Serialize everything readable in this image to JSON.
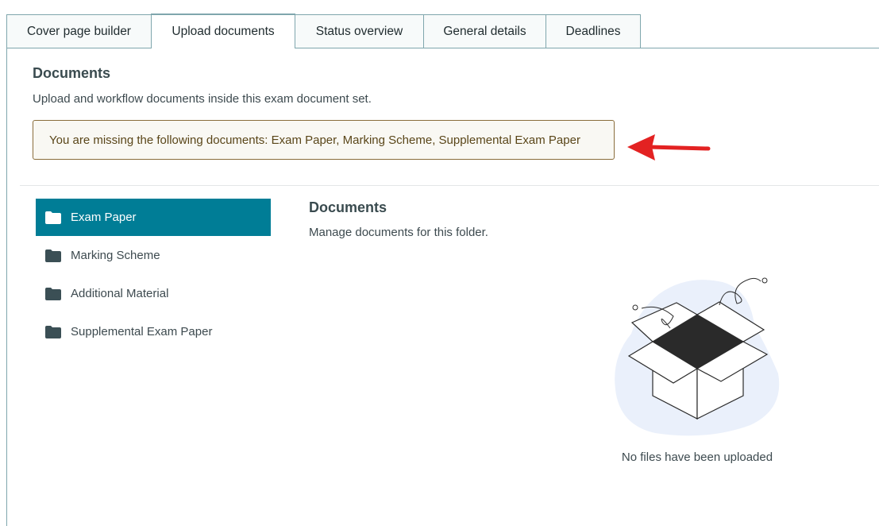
{
  "tabs": [
    {
      "label": "Cover page builder",
      "active": false
    },
    {
      "label": "Upload documents",
      "active": true
    },
    {
      "label": "Status overview",
      "active": false
    },
    {
      "label": "General details",
      "active": false
    },
    {
      "label": "Deadlines",
      "active": false
    }
  ],
  "header": {
    "title": "Documents",
    "description": "Upload and workflow documents inside this exam document set."
  },
  "alert": {
    "message": "You are missing the following documents: Exam Paper, Marking Scheme, Supplemental Exam Paper"
  },
  "folders": [
    {
      "label": "Exam Paper",
      "icon": "folder-icon",
      "active": true
    },
    {
      "label": "Marking Scheme",
      "icon": "folder-icon",
      "active": false
    },
    {
      "label": "Additional Material",
      "icon": "folder-icon",
      "active": false
    },
    {
      "label": "Supplemental Exam Paper",
      "icon": "folder-icon",
      "active": false
    }
  ],
  "documents": {
    "title": "Documents",
    "description": "Manage documents for this folder.",
    "empty_message": "No files have been uploaded"
  },
  "colors": {
    "accent": "#007d96",
    "tab_border": "#7fa6ad",
    "alert_border": "#8a6d3b",
    "annotation_arrow": "#e32222"
  }
}
